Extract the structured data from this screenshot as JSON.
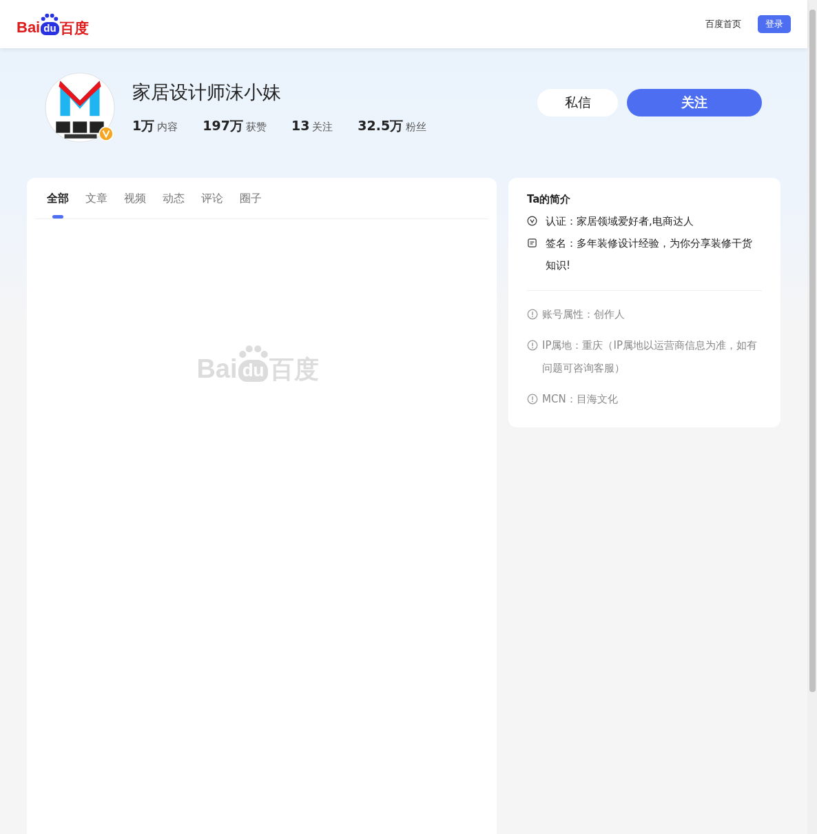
{
  "header": {
    "logo": {
      "left": "Bai",
      "paw": "du",
      "right": "百度"
    },
    "links": [
      {
        "label": "百度首页",
        "kind": "link"
      },
      {
        "label": "登录",
        "kind": "button"
      }
    ]
  },
  "profile": {
    "name": "家居设计师沫小妹",
    "avatar": {
      "kind": "picture",
      "verified": true
    },
    "stats": [
      {
        "value": "1万",
        "label": "内容"
      },
      {
        "value": "197万",
        "label": "获赞"
      },
      {
        "value": "13",
        "label": "关注"
      },
      {
        "value": "32.5万",
        "label": "粉丝"
      }
    ],
    "buttons": [
      {
        "label": "私信",
        "kind": "secondary"
      },
      {
        "label": "关注",
        "kind": "primary"
      }
    ]
  },
  "tabs": [
    {
      "label": "全部",
      "selected": true
    },
    {
      "label": "文章",
      "selected": false
    },
    {
      "label": "视频",
      "selected": false
    },
    {
      "label": "动态",
      "selected": false
    },
    {
      "label": "评论",
      "selected": false
    },
    {
      "label": "圈子",
      "selected": false
    }
  ],
  "empty_logo": {
    "left": "Bai",
    "paw": "du",
    "right": "百度"
  },
  "intro": {
    "title": "Ta的简介",
    "items": [
      {
        "kind": "verify",
        "text": "认证：家居领域爱好者,电商达人"
      },
      {
        "kind": "sign",
        "text": "签名：多年装修设计经验，为你分享装修干货知识!"
      }
    ],
    "details": [
      {
        "text": "账号属性：创作人"
      },
      {
        "text": "IP属地：重庆（IP属地以运营商信息为准，如有问题可咨询客服）"
      },
      {
        "text": "MCN：目海文化"
      }
    ]
  }
}
